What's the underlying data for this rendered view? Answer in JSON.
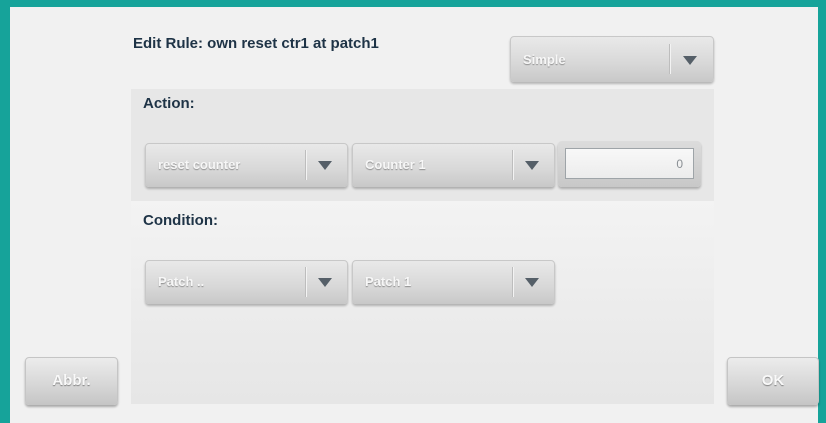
{
  "dialog": {
    "title": "Edit Rule: own reset ctr1 at patch1",
    "mode_select": {
      "value": "Simple"
    }
  },
  "action": {
    "label": "Action:",
    "type_select": {
      "value": "reset counter"
    },
    "target_select": {
      "value": "Counter 1"
    },
    "value_input": {
      "value": "0"
    }
  },
  "condition": {
    "label": "Condition:",
    "type_select": {
      "value": "Patch .."
    },
    "target_select": {
      "value": "Patch 1"
    }
  },
  "footer": {
    "abbr_label": "Abbr.",
    "ok_label": "OK"
  },
  "colors": {
    "accent": "#16a39a",
    "title_text": "#1e3346",
    "dropdown_arrow": "#555f68"
  },
  "icons": {
    "dropdown": "triangle-down"
  }
}
